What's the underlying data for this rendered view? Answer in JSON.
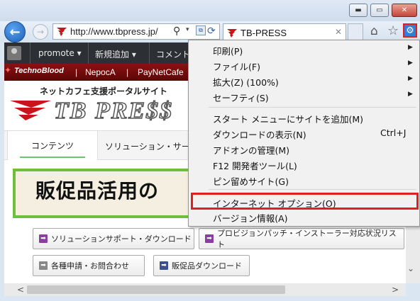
{
  "window": {
    "minimize_glyph": "▬",
    "maximize_glyph": "▭",
    "close_glyph": "✕"
  },
  "nav": {
    "back_glyph": "←",
    "forward_glyph": "→",
    "url": "http://www.tbpress.jp/",
    "search_glyph": "⚲",
    "dropdown_glyph": "▾",
    "refresh_glyph": "⟳",
    "tab_title": "TB-PRESS",
    "tab_close_glyph": "✕",
    "home_glyph": "⌂",
    "favorites_glyph": "☆",
    "tools_glyph": "⚙",
    "icons": [
      "back-icon",
      "forward-icon",
      "search-icon",
      "compatibility-icon",
      "refresh-icon",
      "home-icon",
      "favorites-star-icon",
      "gear-icon"
    ]
  },
  "wpbar": {
    "items": [
      "promote ▾",
      "新規追加 ▾",
      "コメント"
    ]
  },
  "tbbar": {
    "brand": "TechnoBlood",
    "items": [
      "NepocA",
      "PayNetCafe"
    ],
    "separator": "|"
  },
  "header": {
    "tagline": "ネットカフェ支援ポータルサイト",
    "logo": "TB PRE$$"
  },
  "navtabs": {
    "contents": "コンテンツ",
    "solution": "ソリューション・サービス"
  },
  "banner": {
    "text": "販促品活用の"
  },
  "links": [
    {
      "label": "ソリューションサポート・ダウンロード",
      "icon": "➡"
    },
    {
      "label": "プロビジョンパッチ・インストーラー対応状況リスト",
      "icon": "➡"
    },
    {
      "label": "各種申請・お問合わせ",
      "icon": "➡"
    },
    {
      "label": "販促品ダウンロード",
      "icon": "➡"
    }
  ],
  "scroll": {
    "down_glyph": "⌄",
    "left_glyph": "<",
    "right_glyph": ">"
  },
  "menu": {
    "items": [
      {
        "label": "印刷(P)",
        "arrow": "▶"
      },
      {
        "label": "ファイル(F)",
        "arrow": "▶"
      },
      {
        "label": "拡大(Z) (100%)",
        "arrow": "▶"
      },
      {
        "label": "セーフティ(S)",
        "arrow": "▶"
      },
      {
        "label": "スタート メニューにサイトを追加(M)"
      },
      {
        "label": "ダウンロードの表示(N)",
        "shortcut": "Ctrl+J"
      },
      {
        "label": "アドオンの管理(M)"
      },
      {
        "label": "F12 開発者ツール(L)"
      },
      {
        "label": "ピン留めサイト(G)"
      },
      {
        "label": "インターネット オプション(O)"
      },
      {
        "label": "バージョン情報(A)"
      }
    ]
  },
  "colors": {
    "highlight_red": "#e0201e",
    "tb_red": "#8a1212",
    "banner_green": "#6fbf3c"
  }
}
